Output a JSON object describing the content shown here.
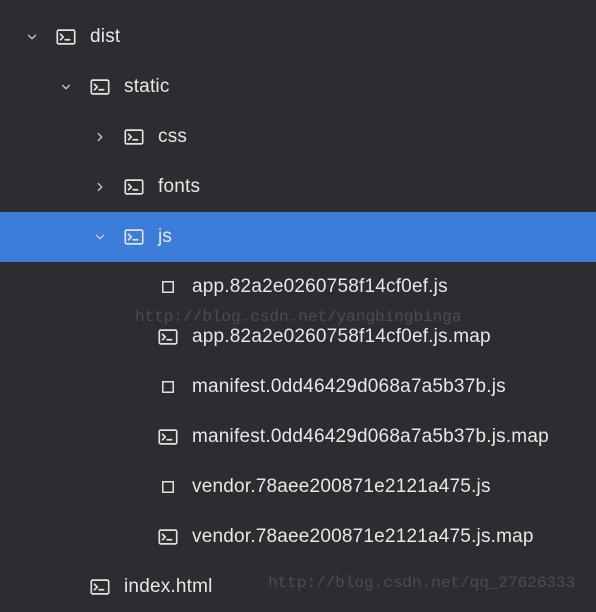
{
  "tree": [
    {
      "id": "dist",
      "label": "dist",
      "depth": 0,
      "chevron": "down",
      "icon": "terminal-folder"
    },
    {
      "id": "static",
      "label": "static",
      "depth": 1,
      "chevron": "down",
      "icon": "terminal-folder"
    },
    {
      "id": "css",
      "label": "css",
      "depth": 2,
      "chevron": "right",
      "icon": "terminal-folder"
    },
    {
      "id": "fonts",
      "label": "fonts",
      "depth": 2,
      "chevron": "right",
      "icon": "terminal-folder"
    },
    {
      "id": "js",
      "label": "js",
      "depth": 2,
      "chevron": "down",
      "icon": "terminal-folder",
      "selected": true
    },
    {
      "id": "appjs",
      "label": "app.82a2e0260758f14cf0ef.js",
      "depth": 3,
      "chevron": "none",
      "icon": "file-outline"
    },
    {
      "id": "appjsmap",
      "label": "app.82a2e0260758f14cf0ef.js.map",
      "depth": 3,
      "chevron": "none",
      "icon": "terminal-folder"
    },
    {
      "id": "manifestjs",
      "label": "manifest.0dd46429d068a7a5b37b.js",
      "depth": 3,
      "chevron": "none",
      "icon": "file-outline"
    },
    {
      "id": "manifestjsmap",
      "label": "manifest.0dd46429d068a7a5b37b.js.map",
      "depth": 3,
      "chevron": "none",
      "icon": "terminal-folder"
    },
    {
      "id": "vendorjs",
      "label": "vendor.78aee200871e2121a475.js",
      "depth": 3,
      "chevron": "none",
      "icon": "file-outline"
    },
    {
      "id": "vendorjsmap",
      "label": "vendor.78aee200871e2121a475.js.map",
      "depth": 3,
      "chevron": "none",
      "icon": "terminal-folder"
    },
    {
      "id": "indexhtml",
      "label": "index.html",
      "depth": 1,
      "chevron": "none",
      "icon": "terminal-folder"
    }
  ],
  "watermarks": {
    "wm1": "http://blog.csdn.net/yangbingbinga",
    "wm2": "http://blog.csdn.net/qq_27626333"
  },
  "indent_base": 20,
  "indent_step": 34
}
